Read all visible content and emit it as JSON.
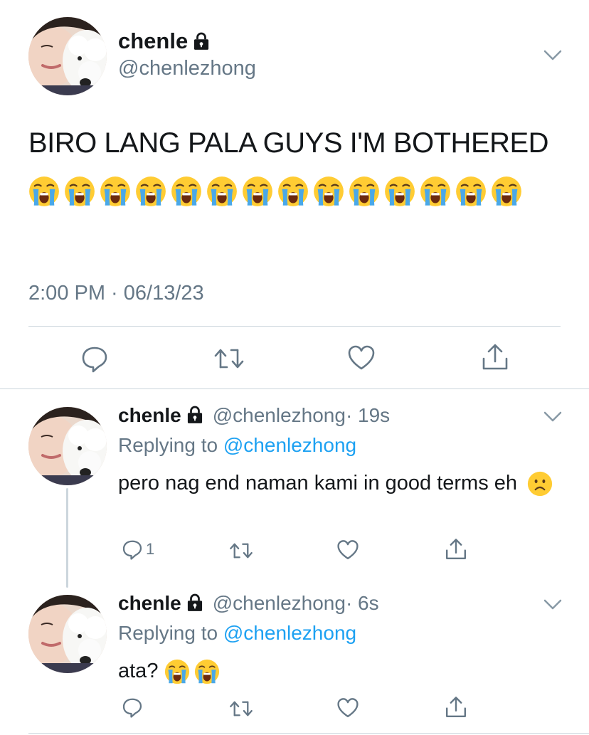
{
  "main_tweet": {
    "display_name": "chenle",
    "handle": "@chenlezhong",
    "text": "BIRO LANG PALA GUYS I'M BOTHERED",
    "emoji_count": 14,
    "emoji": "loudly-crying-face",
    "timestamp": "2:00 PM · 06/13/23"
  },
  "replies": [
    {
      "display_name": "chenle",
      "handle": "@chenlezhong",
      "time": "· 19s",
      "replying_prefix": "Replying to",
      "replying_to": "@chenlezhong",
      "text": "pero nag end naman kami in good terms eh",
      "emoji": "frowning-face",
      "reply_count": "1"
    },
    {
      "display_name": "chenle",
      "handle": "@chenlezhong",
      "time": "· 6s",
      "replying_prefix": "Replying to",
      "replying_to": "@chenlezhong",
      "text": "ata?",
      "emoji_count": 2,
      "emoji": "loudly-crying-face",
      "reply_count": ""
    }
  ],
  "colors": {
    "text": "#14171a",
    "secondary": "#657786",
    "link": "#1da1f2",
    "divider": "#ccd6dd"
  }
}
